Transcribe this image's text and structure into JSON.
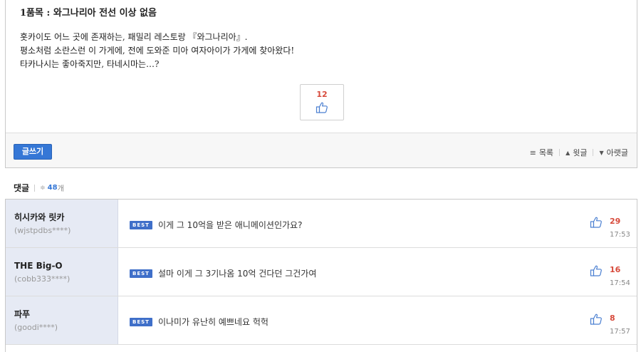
{
  "post": {
    "title": "1품목 : 와그나리아 전선 이상 없음",
    "body": [
      "홋카이도 어느 곳에 존재하는, 패밀리 레스토랑 『와그나리아』.",
      "평소처럼 소란스런 이 가게에, 전에 도와준 미아 여자아이가 가게에 찾아왔다!",
      "타카나시는 좋아죽지만, 타네시마는…?"
    ],
    "like_count": "12",
    "like_icon": "thumbs-up-icon"
  },
  "footer": {
    "write_label": "글쓰기",
    "list_label": "목록",
    "prev_label": "윗글",
    "next_label": "아랫글"
  },
  "comments_header": {
    "title": "댓글",
    "count": "48",
    "unit": "개"
  },
  "comments": [
    {
      "name": "히시카와 릿카",
      "id": "(wjstpdbs****)",
      "badge": "BEST",
      "text": "이게 그 10억을 받은 애니메이션인가요?",
      "likes": "29",
      "time": "17:53"
    },
    {
      "name": "THE Big-O",
      "id": "(cobb333****)",
      "badge": "BEST",
      "text": "설마 이게 그 3기나옴 10억 건다던 그건가여",
      "likes": "16",
      "time": "17:54"
    },
    {
      "name": "파푸",
      "id": "(goodi****)",
      "badge": "BEST",
      "text": "이나미가 유난히 예쁘네요 헉헉",
      "likes": "8",
      "time": "17:57"
    }
  ],
  "colors": {
    "accent_blue": "#3577d6",
    "like_red": "#d74a3b",
    "author_bg": "#e6eaf4"
  }
}
